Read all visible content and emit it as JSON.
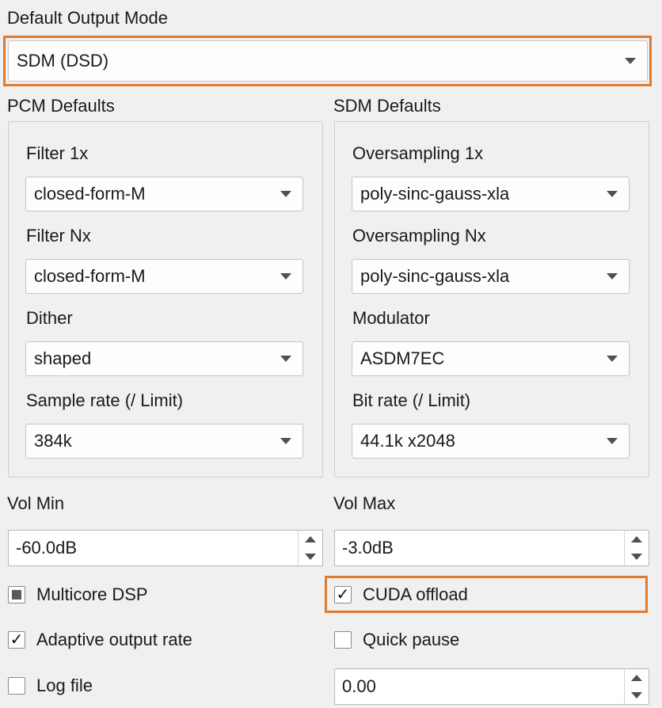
{
  "output_mode": {
    "label": "Default Output Mode",
    "value": "SDM (DSD)"
  },
  "pcm": {
    "title": "PCM Defaults",
    "filter1x": {
      "label": "Filter 1x",
      "value": "closed-form-M"
    },
    "filterNx": {
      "label": "Filter Nx",
      "value": "closed-form-M"
    },
    "dither": {
      "label": "Dither",
      "value": "shaped"
    },
    "sample_rate": {
      "label": "Sample rate (/ Limit)",
      "value": "384k"
    }
  },
  "sdm": {
    "title": "SDM Defaults",
    "oversampling1x": {
      "label": "Oversampling 1x",
      "value": "poly-sinc-gauss-xla"
    },
    "oversamplingNx": {
      "label": "Oversampling Nx",
      "value": "poly-sinc-gauss-xla"
    },
    "modulator": {
      "label": "Modulator",
      "value": "ASDM7EC"
    },
    "bit_rate": {
      "label": "Bit rate (/ Limit)",
      "value": "44.1k x2048"
    }
  },
  "vol_min": {
    "label": "Vol Min",
    "value": "-60.0dB"
  },
  "vol_max": {
    "label": "Vol Max",
    "value": "-3.0dB"
  },
  "options": {
    "multicore": {
      "label": "Multicore DSP",
      "state": "partial"
    },
    "cuda": {
      "label": "CUDA offload",
      "state": "checked",
      "mark": "✓"
    },
    "adaptive": {
      "label": "Adaptive output rate",
      "state": "checked",
      "mark": "✓"
    },
    "quick_pause": {
      "label": "Quick pause",
      "state": "unchecked"
    },
    "log_file": {
      "label": "Log file",
      "state": "unchecked"
    }
  },
  "quick_pause_value": "0.00",
  "colors": {
    "highlight": "#e07b2e",
    "background": "#f0f0f0"
  }
}
